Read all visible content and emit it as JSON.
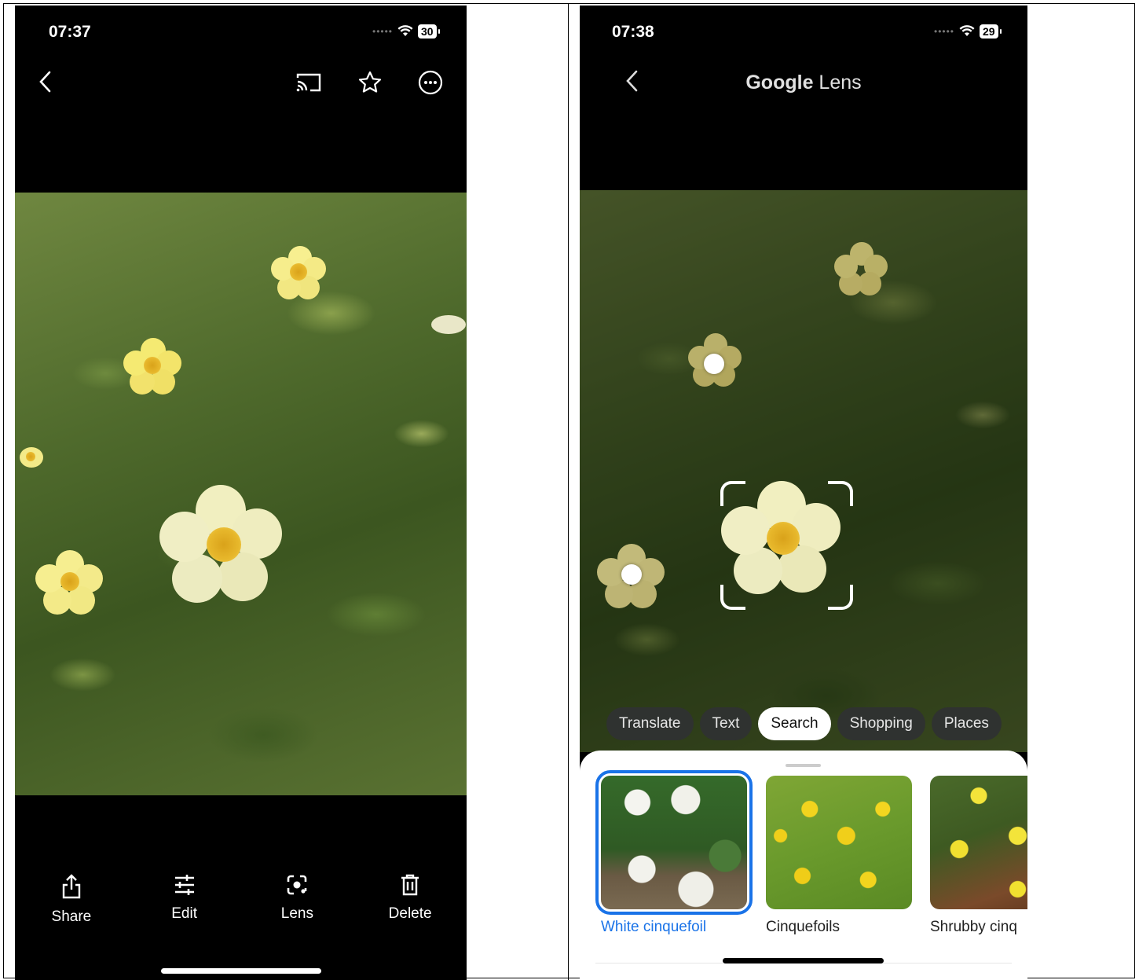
{
  "left_screen": {
    "status": {
      "time": "07:37",
      "battery": "30"
    },
    "top_icons": [
      "back-icon",
      "cast-icon",
      "star-icon",
      "more-icon"
    ],
    "bottom_actions": [
      {
        "label": "Share",
        "icon": "share-icon"
      },
      {
        "label": "Edit",
        "icon": "edit-sliders-icon"
      },
      {
        "label": "Lens",
        "icon": "lens-icon"
      },
      {
        "label": "Delete",
        "icon": "trash-icon"
      }
    ]
  },
  "right_screen": {
    "status": {
      "time": "07:38",
      "battery": "29"
    },
    "title_google": "Google",
    "title_lens": "Lens",
    "chips": [
      "Translate",
      "Text",
      "Search",
      "Shopping",
      "Places"
    ],
    "active_chip": "Search",
    "results": [
      {
        "label": "White cinquefoil",
        "selected": true
      },
      {
        "label": "Cinquefoils",
        "selected": false
      },
      {
        "label": "Shrubby cinq",
        "selected": false
      }
    ]
  },
  "colors": {
    "accent": "#1a73e8",
    "background": "#000000",
    "chip_bg": "#2f3230"
  }
}
